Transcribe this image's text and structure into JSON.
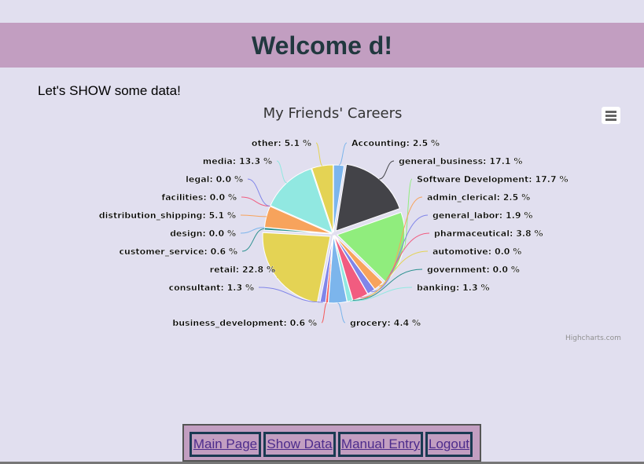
{
  "header": {
    "title": "Welcome d!"
  },
  "intro": "Let's SHOW some data!",
  "chart_data": {
    "type": "pie",
    "title": "My Friends' Careers",
    "credits": "Highcharts.com",
    "series": [
      {
        "name": "Accounting",
        "value": 2.5,
        "label": "Accounting: 2.5 %",
        "color": "#7cb5ec"
      },
      {
        "name": "general_business",
        "value": 17.1,
        "label": "general_business: 17.1 %",
        "color": "#434348"
      },
      {
        "name": "Software Development",
        "value": 17.7,
        "label": "Software Development: 17.7 %",
        "color": "#90ed7d"
      },
      {
        "name": "admin_clerical",
        "value": 2.5,
        "label": "admin_clerical: 2.5 %",
        "color": "#f7a35c"
      },
      {
        "name": "general_labor",
        "value": 1.9,
        "label": "general_labor: 1.9 %",
        "color": "#8085e9"
      },
      {
        "name": "pharmaceutical",
        "value": 3.8,
        "label": "pharmaceutical: 3.8 %",
        "color": "#f15c80"
      },
      {
        "name": "automotive",
        "value": 0.0,
        "label": "automotive: 0.0 %",
        "color": "#e4d354"
      },
      {
        "name": "government",
        "value": 0.0,
        "label": "government: 0.0 %",
        "color": "#2b908f"
      },
      {
        "name": "banking",
        "value": 1.3,
        "label": "banking: 1.3 %",
        "color": "#91e8e1"
      },
      {
        "name": "grocery",
        "value": 4.4,
        "label": "grocery: 4.4 %",
        "color": "#7cb5ec"
      },
      {
        "name": "business_development",
        "value": 0.6,
        "label": "business_development: 0.6 %",
        "color": "#f45b5b"
      },
      {
        "name": "consultant",
        "value": 1.3,
        "label": "consultant: 1.3 %",
        "color": "#8085e9"
      },
      {
        "name": "retail",
        "value": 22.8,
        "label": "retail: 22.8 %",
        "color": "#e4d354"
      },
      {
        "name": "customer_service",
        "value": 0.6,
        "label": "customer_service: 0.6 %",
        "color": "#2b908f"
      },
      {
        "name": "design",
        "value": 0.0,
        "label": "design: 0.0 %",
        "color": "#7cb5ec"
      },
      {
        "name": "distribution_shipping",
        "value": 5.1,
        "label": "distribution_shipping: 5.1 %",
        "color": "#f7a35c"
      },
      {
        "name": "facilities",
        "value": 0.0,
        "label": "facilities: 0.0 %",
        "color": "#f15c80"
      },
      {
        "name": "legal",
        "value": 0.0,
        "label": "legal: 0.0 %",
        "color": "#8085e9"
      },
      {
        "name": "media",
        "value": 13.3,
        "label": "media: 13.3 %",
        "color": "#91e8e1"
      },
      {
        "name": "other",
        "value": 5.1,
        "label": "other: 5.1 %",
        "color": "#e4d354"
      }
    ]
  },
  "nav": {
    "main": "Main Page",
    "show": "Show Data",
    "manual": "Manual Entry",
    "logout": "Logout"
  }
}
